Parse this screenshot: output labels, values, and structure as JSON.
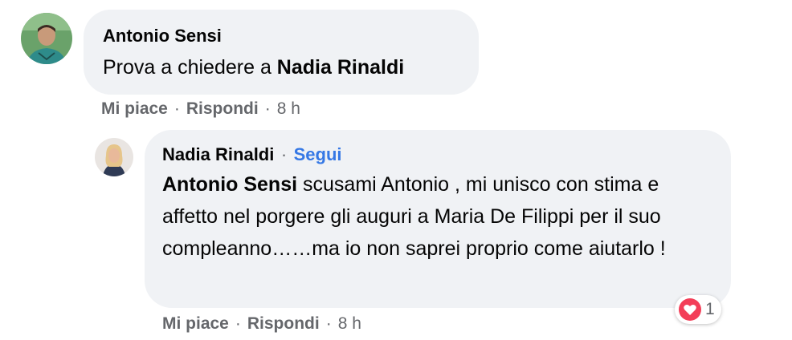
{
  "comment1": {
    "author": "Antonio Sensi",
    "text_before": "Prova a chiedere a ",
    "mention": "Nadia Rinaldi",
    "actions": {
      "like": "Mi piace",
      "reply": "Rispondi",
      "time": "8 h"
    }
  },
  "comment2": {
    "author": "Nadia Rinaldi",
    "follow_sep": "·",
    "follow": "Segui",
    "mention": "Antonio Sensi",
    "text_after": " scusami Antonio , mi unisco con stima e affetto nel porgere gli auguri a Maria De Filippi per il suo compleanno……ma io non saprei proprio come aiutarlo !",
    "reactions": {
      "icon": "heart-icon",
      "count": "1",
      "color": "#f33e58"
    },
    "actions": {
      "like": "Mi piace",
      "reply": "Rispondi",
      "time": "8 h"
    }
  },
  "colors": {
    "bubble": "#f0f2f5",
    "secondary_text": "#65676b",
    "link": "#3578e5"
  }
}
